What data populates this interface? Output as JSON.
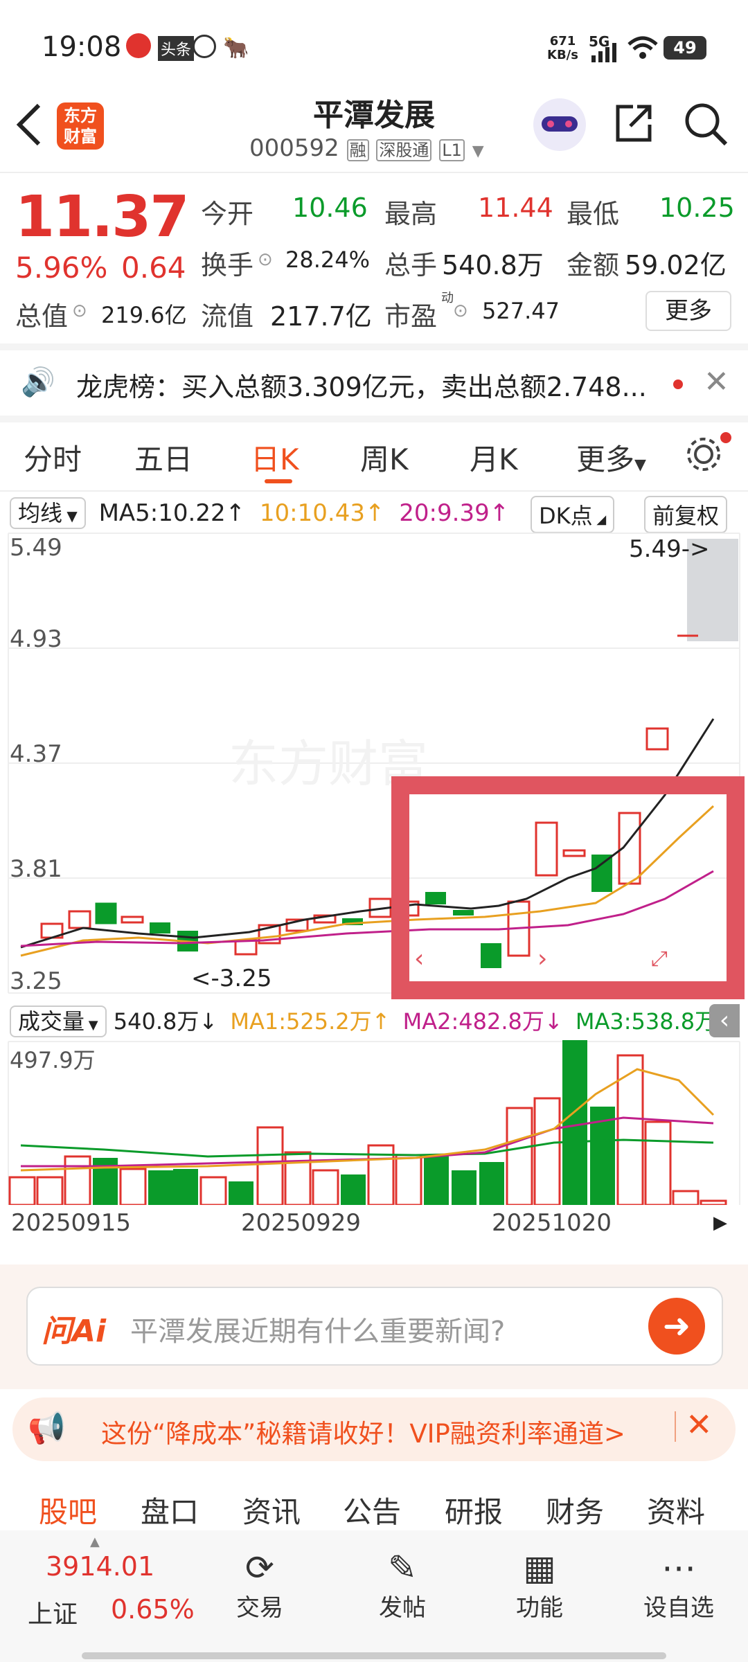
{
  "status": {
    "time": "19:08",
    "net_speed_top": "671",
    "net_speed_bottom": "KB/s",
    "signal": "5G",
    "battery": "49"
  },
  "nav": {
    "brand_line1": "东方",
    "brand_line2": "财富",
    "title": "平潭发展",
    "code": "000592",
    "tag1": "融",
    "tag2": "深股通",
    "tag3": "L1"
  },
  "quote": {
    "price": "11.37",
    "change_pct": "5.96%",
    "change": "0.64",
    "open_label": "今开",
    "open": "10.46",
    "high_label": "最高",
    "high": "11.44",
    "low_label": "最低",
    "low": "10.25",
    "turnover_label": "换手",
    "turnover": "28.24%",
    "volume_label": "总手",
    "volume": "540.8万",
    "amount_label": "金额",
    "amount": "59.02亿",
    "mcap_label": "总值",
    "mcap": "219.6亿",
    "float_label": "流值",
    "float": "217.7亿",
    "pe_label": "市盈",
    "pe_sup": "动",
    "pe": "527.47",
    "more": "更多"
  },
  "notice": {
    "text": "龙虎榜：买入总额3.309亿元，卖出总额2.748..."
  },
  "tabs": [
    "分时",
    "五日",
    "日K",
    "周K",
    "月K",
    "更多"
  ],
  "kline": {
    "ma_label": "均线",
    "ma5": "MA5:10.22",
    "ma10": "10:10.43",
    "ma20": "20:9.39",
    "dk": "DK点",
    "fq": "前复权",
    "y_labels": [
      "5.49",
      "4.93",
      "4.37",
      "3.81",
      "3.25"
    ],
    "max_tag": "5.49->",
    "min_tag": "<-3.25",
    "watermark": "东方财富"
  },
  "volume": {
    "label": "成交量",
    "value": "540.8万",
    "ma1": "MA1:525.2万",
    "ma2": "MA2:482.8万",
    "ma3": "MA3:538.8万",
    "max": "497.9万",
    "dates": [
      "20250915",
      "20250929",
      "20251020"
    ]
  },
  "ai": {
    "logo": "问Ai",
    "placeholder": "平潭发展近期有什么重要新闻?"
  },
  "promo": {
    "text": "这份“降成本”秘籍请收好！VIP融资利率通道>"
  },
  "bottom_tabs": [
    "股吧",
    "盘口",
    "资讯",
    "公告",
    "研报",
    "财务",
    "资料"
  ],
  "footer": {
    "index_value": "3914.01",
    "index_name": "上证",
    "index_pct": "0.65%",
    "trade": "交易",
    "post": "发帖",
    "func": "功能",
    "watch": "设自选"
  },
  "colors": {
    "accent": "#f0501e",
    "up": "#e0332e",
    "down": "#0a9b2a"
  }
}
